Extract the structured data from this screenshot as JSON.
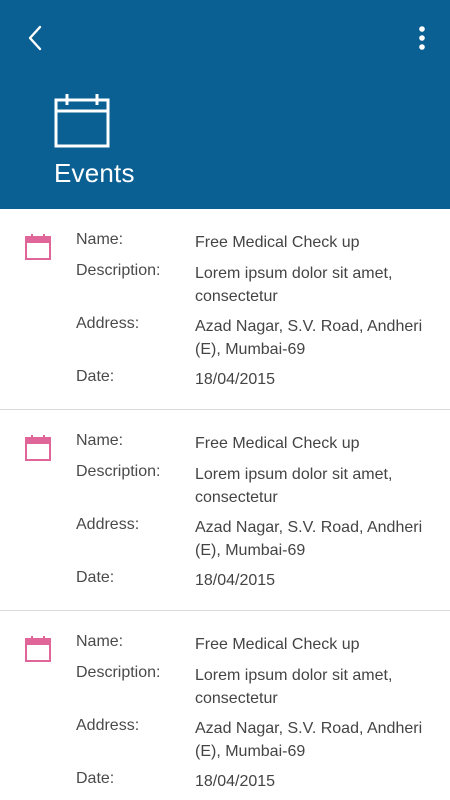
{
  "header": {
    "title": "Events",
    "back_icon": "chevron-left-icon",
    "menu_icon": "more-vertical-icon",
    "calendar_icon": "calendar-icon",
    "bg_color": "#0a5f93"
  },
  "labels": {
    "name": "Name:",
    "description": "Description:",
    "address": "Address:",
    "date": "Date:"
  },
  "events": [
    {
      "name": "Free Medical Check up",
      "description": "Lorem ipsum dolor sit amet, consectetur",
      "address": "Azad Nagar, S.V. Road, Andheri (E), Mumbai-69",
      "date": "18/04/2015"
    },
    {
      "name": "Free Medical Check up",
      "description": "Lorem ipsum dolor sit amet, consectetur",
      "address": "Azad Nagar, S.V. Road, Andheri (E), Mumbai-69",
      "date": "18/04/2015"
    },
    {
      "name": "Free Medical Check up",
      "description": "Lorem ipsum dolor sit amet, consectetur",
      "address": "Azad Nagar, S.V. Road, Andheri (E), Mumbai-69",
      "date": "18/04/2015"
    }
  ],
  "colors": {
    "accent_pink": "#e0669a"
  }
}
